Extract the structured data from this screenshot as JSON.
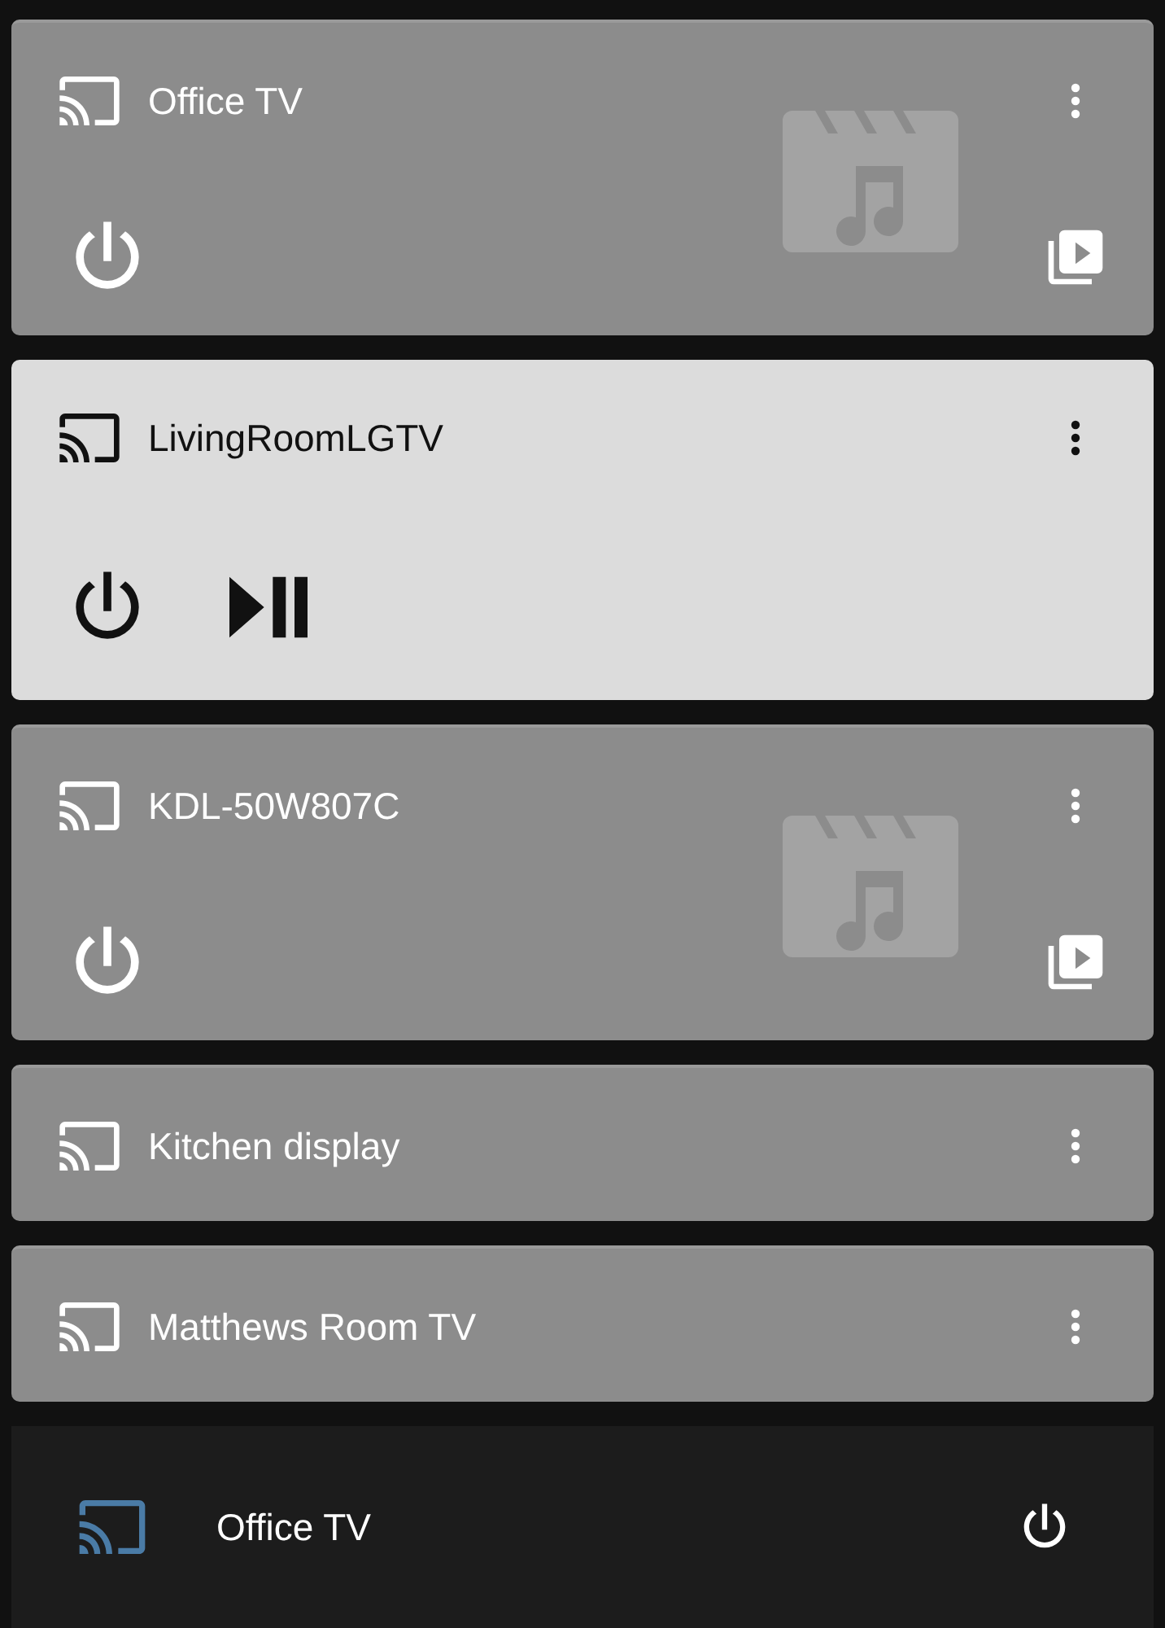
{
  "devices": [
    {
      "name": "Office TV",
      "kind": "full",
      "active": false,
      "media_placeholder": true,
      "controls": [
        {
          "kind": "power"
        },
        {
          "kind": "browse_media"
        }
      ]
    },
    {
      "name": "LivingRoomLGTV",
      "kind": "full",
      "active": true,
      "media_placeholder": false,
      "controls": [
        {
          "kind": "power"
        },
        {
          "kind": "play_pause"
        }
      ]
    },
    {
      "name": "KDL-50W807C",
      "kind": "full",
      "active": false,
      "media_placeholder": true,
      "controls": [
        {
          "kind": "power"
        },
        {
          "kind": "browse_media"
        }
      ]
    },
    {
      "name": "Kitchen display",
      "kind": "compact",
      "active": false,
      "media_placeholder": false
    },
    {
      "name": "Matthews Room TV",
      "kind": "compact",
      "active": false,
      "media_placeholder": false
    }
  ],
  "cast_bar": {
    "name": "Office TV"
  }
}
